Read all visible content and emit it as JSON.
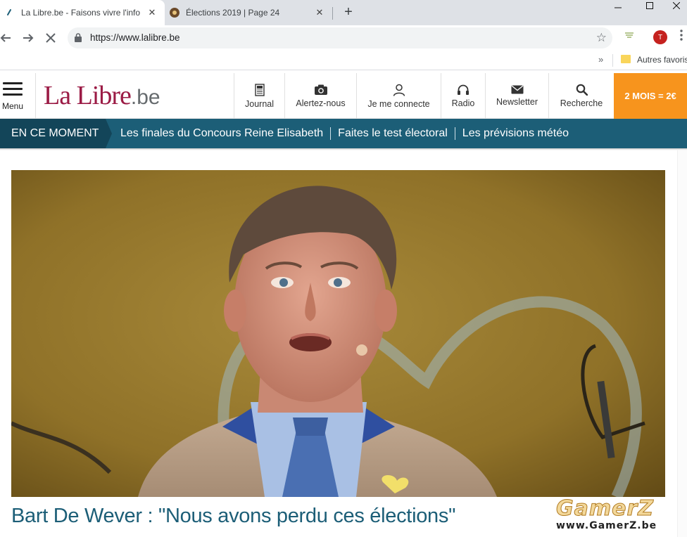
{
  "browser": {
    "tabs": [
      {
        "title": "La Libre.be - Faisons vivre l'info",
        "active": true,
        "favicon": "lalibre-favicon"
      },
      {
        "title": "Élections 2019 | Page 24",
        "active": false,
        "favicon": "forum-favicon"
      }
    ],
    "url": "https://www.lalibre.be",
    "bookmarks": {
      "folder_label": "Autres favoris"
    },
    "profile_initial": "T"
  },
  "site": {
    "logo": {
      "name": "La Libre",
      "tld": ".be"
    },
    "menu_label": "Menu",
    "header_items": [
      {
        "label": "Journal",
        "icon": "newspaper-icon"
      },
      {
        "label": "Alertez-nous",
        "icon": "camera-icon"
      },
      {
        "label": "Je me connecte",
        "icon": "user-icon"
      },
      {
        "label": "Radio",
        "icon": "headphones-icon"
      },
      {
        "label": "Newsletter",
        "icon": "envelope-icon"
      },
      {
        "label": "Recherche",
        "icon": "search-icon"
      }
    ],
    "subscribe_cta": "2 MOIS = 2€",
    "trending": {
      "lead": "EN CE MOMENT",
      "links": [
        "Les finales du Concours Reine Elisabeth",
        "Faites le test électoral",
        "Les prévisions météo"
      ]
    },
    "article": {
      "headline": "Bart De Wever : \"Nous avons perdu ces élections\""
    }
  },
  "watermark": {
    "title": "GamerZ",
    "url": "www.GamerZ.be"
  },
  "colors": {
    "brand_red": "#9b1b45",
    "brand_teal": "#1c5e77",
    "cta_orange": "#f7941d"
  }
}
